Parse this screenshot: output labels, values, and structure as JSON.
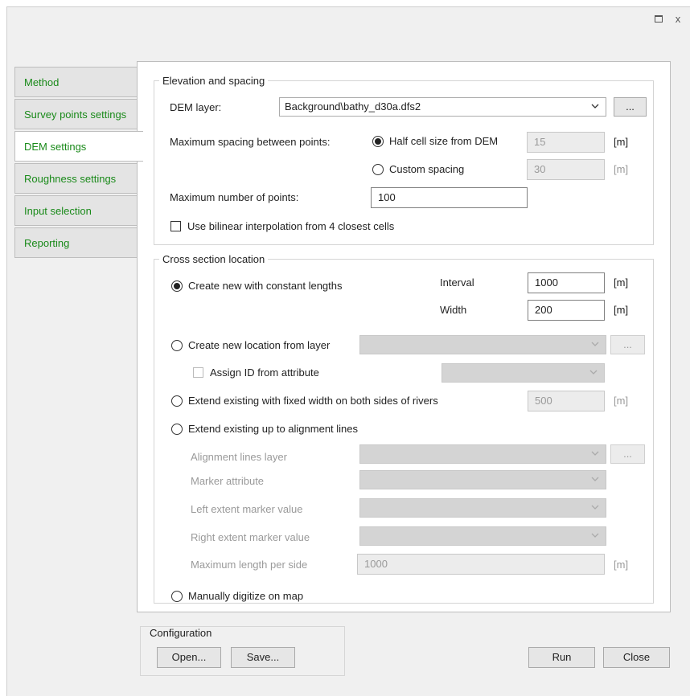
{
  "window": {
    "maximize_icon": "maximize-icon",
    "close_glyph": "x"
  },
  "tabs": [
    {
      "label": "Method"
    },
    {
      "label": "Survey points settings"
    },
    {
      "label": "DEM settings"
    },
    {
      "label": "Roughness settings"
    },
    {
      "label": "Input selection"
    },
    {
      "label": "Reporting"
    }
  ],
  "active_tab": "DEM settings",
  "elevation": {
    "legend": "Elevation and spacing",
    "dem_layer_label": "DEM layer:",
    "dem_layer_value": "Background\\bathy_d30a.dfs2",
    "browse_label": "...",
    "max_spacing_label": "Maximum spacing between points:",
    "half_cell_label": "Half cell size from DEM",
    "half_cell_value": "15",
    "custom_spacing_label": "Custom spacing",
    "custom_spacing_value": "30",
    "unit": "[m]",
    "max_points_label": "Maximum number of points:",
    "max_points_value": "100",
    "bilinear_label": "Use bilinear interpolation from 4 closest cells",
    "selected_spacing": "half_cell",
    "bilinear_checked": false
  },
  "cross_section": {
    "legend": "Cross section location",
    "create_constant_label": "Create new with constant lengths",
    "interval_label": "Interval",
    "interval_value": "1000",
    "width_label": "Width",
    "width_value": "200",
    "unit": "[m]",
    "create_from_layer_label": "Create new location from layer",
    "layer_value": "",
    "browse_label": "...",
    "assign_id_label": "Assign ID from attribute",
    "extend_fixed_label": "Extend existing with fixed width on both sides of rivers",
    "extend_fixed_value": "500",
    "extend_alignment_label": "Extend existing up to alignment lines",
    "alignment_layer_label": "Alignment lines layer",
    "marker_attribute_label": "Marker attribute",
    "left_marker_label": "Left extent marker value",
    "right_marker_label": "Right extent marker value",
    "max_length_label": "Maximum length per side",
    "max_length_value": "1000",
    "manual_label": "Manually digitize on map",
    "selected_option": "constant"
  },
  "configuration": {
    "legend": "Configuration",
    "open_label": "Open...",
    "save_label": "Save..."
  },
  "actions": {
    "run_label": "Run",
    "close_label": "Close"
  },
  "colors": {
    "tab_text": "#1a8a1a",
    "disabled_fill": "#d4d4d4",
    "window_bg": "#f0f0f0"
  }
}
